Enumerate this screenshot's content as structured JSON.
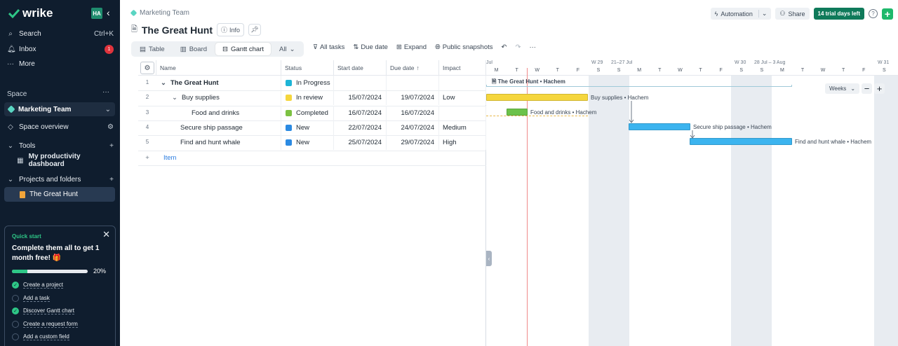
{
  "app": {
    "logo_text": "wrike",
    "avatar_initials": "HA",
    "search_label": "Search",
    "search_shortcut": "Ctrl+K",
    "inbox_label": "Inbox",
    "inbox_count": "1",
    "more_label": "More",
    "space_section": "Space",
    "space_name": "Marketing Team",
    "space_overview": "Space overview",
    "tools_label": "Tools",
    "productivity_dashboard": "My productivity dashboard",
    "projects_label": "Projects and folders",
    "active_project": "The Great Hunt"
  },
  "quick_start": {
    "title": "Quick start",
    "headline": "Complete them all to get 1 month free! 🎁",
    "progress_percent": 20,
    "progress_label": "20%",
    "items": [
      {
        "label": "Create a project",
        "done": true
      },
      {
        "label": "Add a task",
        "done": false
      },
      {
        "label": "Discover Gantt chart",
        "done": true
      },
      {
        "label": "Create a request form",
        "done": false
      },
      {
        "label": "Add a custom field",
        "done": false
      }
    ]
  },
  "header": {
    "breadcrumb": "Marketing Team",
    "title": "The Great Hunt",
    "info_label": "Info",
    "automation_label": "Automation",
    "share_label": "Share",
    "trial_label": "14 trial days left"
  },
  "views": {
    "table": "Table",
    "board": "Board",
    "gantt": "Gantt chart",
    "filter": "All"
  },
  "toolbar": {
    "all_tasks": "All tasks",
    "due_date": "Due date",
    "expand": "Expand",
    "public_snapshots": "Public snapshots"
  },
  "table": {
    "columns": {
      "name": "Name",
      "status": "Status",
      "start": "Start date",
      "due": "Due date",
      "impact": "Impact"
    },
    "rows": [
      {
        "num": "1",
        "name": "The Great Hunt",
        "status": "In Progress",
        "status_color": "#1db4d6",
        "start": "",
        "due": "",
        "impact": ""
      },
      {
        "num": "2",
        "name": "Buy supplies",
        "status": "In review",
        "status_color": "#f5d63d",
        "start": "15/07/2024",
        "due": "19/07/2024",
        "impact": "Low"
      },
      {
        "num": "3",
        "name": "Food and drinks",
        "status": "Completed",
        "status_color": "#7cc142",
        "start": "16/07/2024",
        "due": "16/07/2024",
        "impact": ""
      },
      {
        "num": "4",
        "name": "Secure ship passage",
        "status": "New",
        "status_color": "#2b8ae2",
        "start": "22/07/2024",
        "due": "24/07/2024",
        "impact": "Medium"
      },
      {
        "num": "5",
        "name": "Find and hunt whale",
        "status": "New",
        "status_color": "#2b8ae2",
        "start": "25/07/2024",
        "due": "29/07/2024",
        "impact": "High"
      }
    ],
    "add_item": "Item"
  },
  "gantt": {
    "weeks": [
      {
        "label": "Jul"
      },
      {
        "label": "W 29"
      },
      {
        "label": "21–27 Jul"
      },
      {
        "label": "W 30"
      },
      {
        "label": "28 Jul – 3 Aug"
      },
      {
        "label": "W 31"
      }
    ],
    "days": [
      "M",
      "T",
      "W",
      "T",
      "F",
      "S",
      "S",
      "M",
      "T",
      "W",
      "T",
      "F",
      "S",
      "S",
      "M",
      "T",
      "W",
      "T",
      "F",
      "S",
      "S"
    ],
    "scale_label": "Weeks",
    "project_bar_label": "The Great Hunt • Hachem",
    "bars": [
      {
        "label": "Buy supplies • Hachem",
        "color": "#f5d63d"
      },
      {
        "label": "Food and drinks • Hachem",
        "color": "#6cc24a"
      },
      {
        "label": "Secure ship passage • Hachem",
        "color": "#3cb4ef"
      },
      {
        "label": "Find and hunt whale • Hachem",
        "color": "#3cb4ef"
      }
    ]
  }
}
